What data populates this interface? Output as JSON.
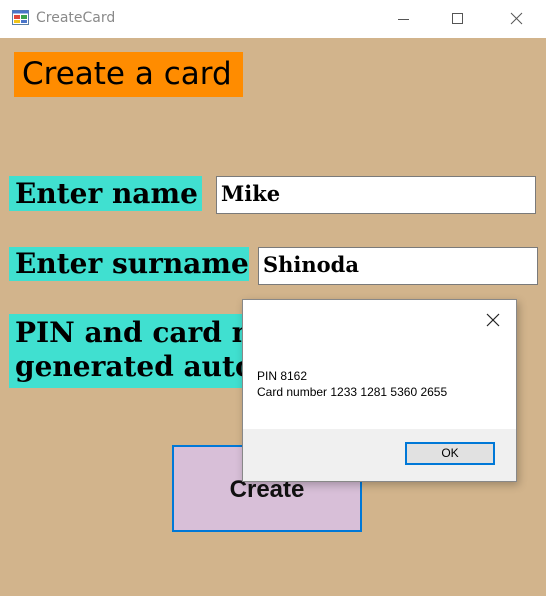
{
  "window": {
    "title": "CreateCard"
  },
  "form": {
    "heading": "Create a card",
    "name_label": "Enter name",
    "name_value": "Mike",
    "surname_label": "Enter surname",
    "surname_value": "Shinoda",
    "pin_info_line1": "PIN and card n",
    "pin_info_line2": "generated autom",
    "create_button": "Create"
  },
  "dialog": {
    "pin_text": "PIN 8162",
    "card_text": "Card number 1233 1281 5360 2655",
    "ok_button": "OK"
  },
  "colors": {
    "background": "#d2b48c",
    "heading_bg": "#ff8c00",
    "label_bg": "#40e0d0",
    "button_bg": "#d8bfd8",
    "focus_border": "#0078d7"
  },
  "icons": [
    "app-icon",
    "minimize-icon",
    "maximize-icon",
    "close-icon"
  ]
}
